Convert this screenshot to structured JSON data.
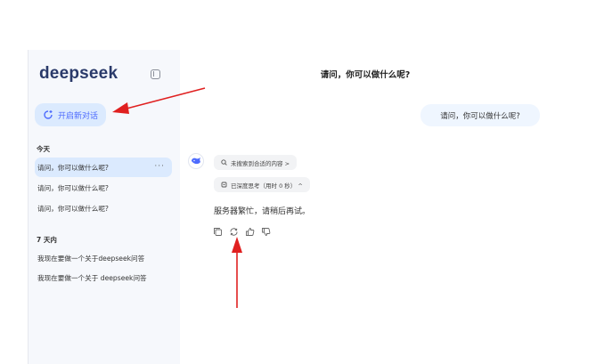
{
  "sidebar": {
    "logo": "deepseek",
    "new_chat_label": "开启新对话",
    "sections": [
      {
        "label": "今天",
        "items": [
          "请问，你可以做什么呢?",
          "请问，你可以做什么呢?",
          "请问，你可以做什么呢?"
        ]
      },
      {
        "label": "7 天内",
        "items": [
          "我现在要做一个关于deepseek问答",
          "我现在要做一个关于 deepseek问答"
        ]
      }
    ],
    "more_label": "···"
  },
  "main": {
    "title": "请问，你可以做什么呢?",
    "user_message": "请问，你可以做什么呢?",
    "search_pill": "未搜索到合适的内容 >",
    "think_pill": "已深度思考（用时 0 秒） ^",
    "answer": "服务器繁忙，请稍后再试。"
  },
  "colors": {
    "accent": "#4d6bfe",
    "active_bg": "#dbeafe",
    "sidebar_bg": "#f6f8fc",
    "annotation_arrow": "#e02020"
  },
  "icons": [
    "collapse-sidebar-icon",
    "new-chat-icon",
    "more-icon",
    "deepseek-whale-icon",
    "search-icon",
    "think-icon",
    "copy-icon",
    "regenerate-icon",
    "like-icon",
    "dislike-icon",
    "annotation-arrow"
  ]
}
